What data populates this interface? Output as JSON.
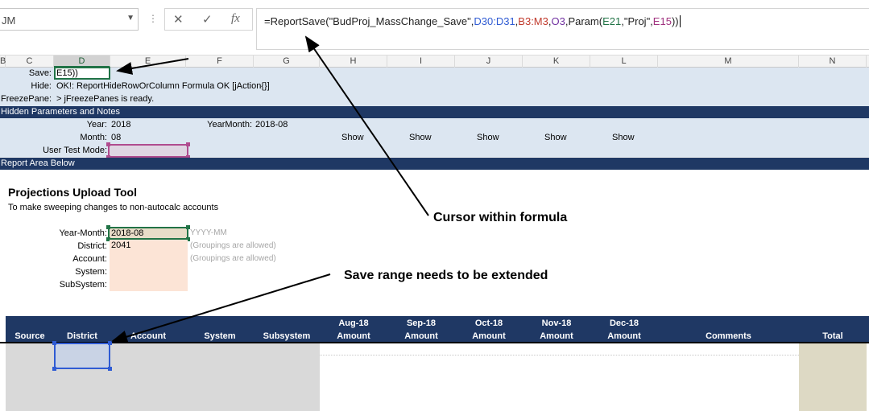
{
  "formula_bar": {
    "name_box": "JM",
    "dots": "⋮",
    "cancel_icon": "✕",
    "enter_icon": "✓",
    "fx_icon": "fx",
    "formula_parts": [
      {
        "text": "=ReportSave(\"BudProj_MassChange_Save\",",
        "color": "#222222"
      },
      {
        "text": "D30:D31",
        "color": "#2f5bd3"
      },
      {
        "text": ",",
        "color": "#222222"
      },
      {
        "text": "B3:M3",
        "color": "#c0392b"
      },
      {
        "text": ",",
        "color": "#222222"
      },
      {
        "text": "O3",
        "color": "#7030a0"
      },
      {
        "text": ",Param(",
        "color": "#222222"
      },
      {
        "text": "E21",
        "color": "#217346"
      },
      {
        "text": ",\"Proj\",",
        "color": "#222222"
      },
      {
        "text": "E15",
        "color": "#a0327f"
      },
      {
        "text": "))",
        "color": "#222222"
      }
    ]
  },
  "columns": [
    "B",
    "C",
    "D",
    "E",
    "F",
    "G",
    "H",
    "I",
    "J",
    "K",
    "L",
    "M",
    "N"
  ],
  "rows": {
    "save_label": "Save:",
    "save_value": "E15))",
    "hide_label": "Hide:",
    "hide_value": "OK!: ReportHideRowOrColumn Formula OK [jAction{}]",
    "freeze_label": "FreezePane:",
    "freeze_value": "> jFreezePanes is ready.",
    "hidden_params_title": "Hidden Parameters and Notes",
    "year_label": "Year:",
    "year_value": "2018",
    "yearmonth_label": "YearMonth:",
    "yearmonth_value": "2018-08",
    "month_label": "Month:",
    "month_value": "08",
    "show_labels": [
      "Show",
      "Show",
      "Show",
      "Show",
      "Show"
    ],
    "user_test_label": "User Test Mode:",
    "report_area_title": "Report Area Below"
  },
  "tool": {
    "title": "Projections Upload Tool",
    "subtitle": "To make sweeping changes to non-autocalc accounts",
    "year_month_label": "Year-Month:",
    "year_month_value": "2018-08",
    "year_month_hint": "YYYY-MM",
    "district_label": "District:",
    "district_value": "2041",
    "district_hint": "(Groupings are allowed)",
    "account_label": "Account:",
    "account_hint": "(Groupings are allowed)",
    "system_label": "System:",
    "subsystem_label": "SubSystem:"
  },
  "table": {
    "headers": [
      "Source",
      "District",
      "Account",
      "System",
      "Subsystem"
    ],
    "months": [
      {
        "month": "Aug-18",
        "sub": "Amount"
      },
      {
        "month": "Sep-18",
        "sub": "Amount"
      },
      {
        "month": "Oct-18",
        "sub": "Amount"
      },
      {
        "month": "Nov-18",
        "sub": "Amount"
      },
      {
        "month": "Dec-18",
        "sub": "Amount"
      }
    ],
    "comments": "Comments",
    "total": "Total"
  },
  "annotations": {
    "cursor": "Cursor within formula",
    "save_range": "Save range needs to be extended"
  },
  "colors": {
    "header_dark": "#1f3864",
    "band_light": "#dce6f1",
    "selection_green": "#217346",
    "peach_input": "#fce4d6"
  }
}
